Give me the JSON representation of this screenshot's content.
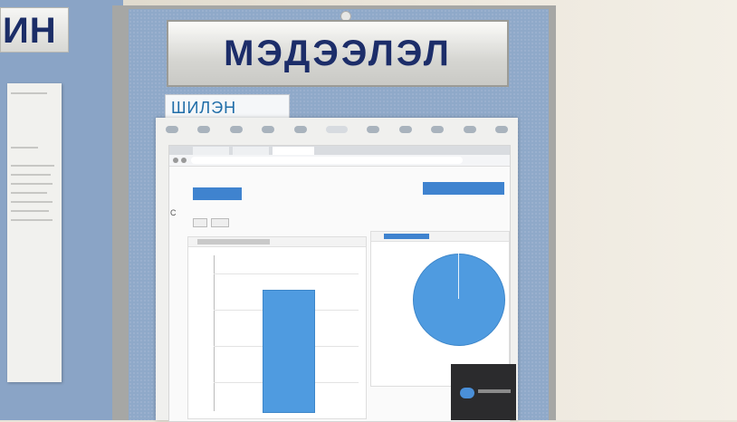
{
  "board": {
    "title": "МЭДЭЭЛЭЛ",
    "subtitle": "ШИЛЭН ДАНС",
    "left_plate_fragment": "ИН"
  },
  "colors": {
    "board_felt": "#8fa9c9",
    "plate_text": "#1c2d69",
    "subtitle_text": "#1f6da8",
    "chart_blue": "#4f9be0",
    "highlight_blue": "#3f83cf"
  },
  "print": {
    "charts": [
      "bar-chart",
      "pie-chart"
    ],
    "bar_chart_bar_level": 0.78,
    "pie_chart_fill": 1.0
  }
}
